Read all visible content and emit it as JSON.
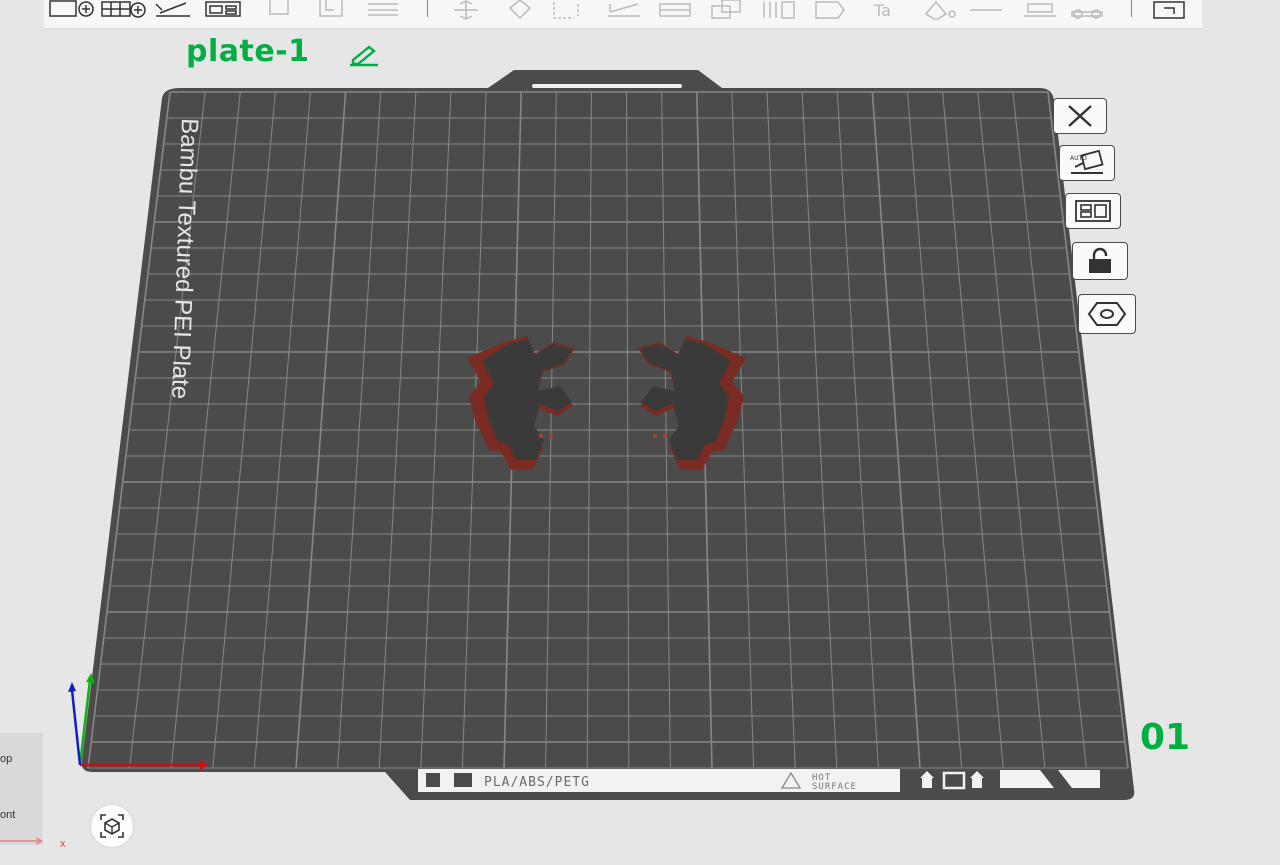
{
  "toolbar": {
    "icons": [
      "add-object-icon",
      "add-grid-icon",
      "orient-icon",
      "arrange-icon",
      "cut-icon",
      "split-icon",
      "layers-icon",
      "move-icon",
      "rotate-icon",
      "scale-icon",
      "flatten-icon",
      "place-face-icon",
      "boolean-icon",
      "support-paint-icon",
      "seam-paint-icon",
      "text-icon",
      "color-paint-icon",
      "measure-icon",
      "assembly-icon",
      "emboss-icon",
      "variable-layer-icon"
    ]
  },
  "plate": {
    "name": "plate-1",
    "bed_label": "Bambu Textured PEI Plate",
    "index": "01",
    "filament_label": "PLA/ABS/PETG",
    "hot_surface_label": "HOT\nSURFACE"
  },
  "side_panel": {
    "label_top": "op",
    "label_front": "ont",
    "axis_label": "x"
  },
  "colors": {
    "accent": "#00ae42",
    "bed": "#4a4b4a",
    "grid": "#8b8b8b",
    "model": "#3a3a3a",
    "model_edge": "#7a2c22"
  }
}
